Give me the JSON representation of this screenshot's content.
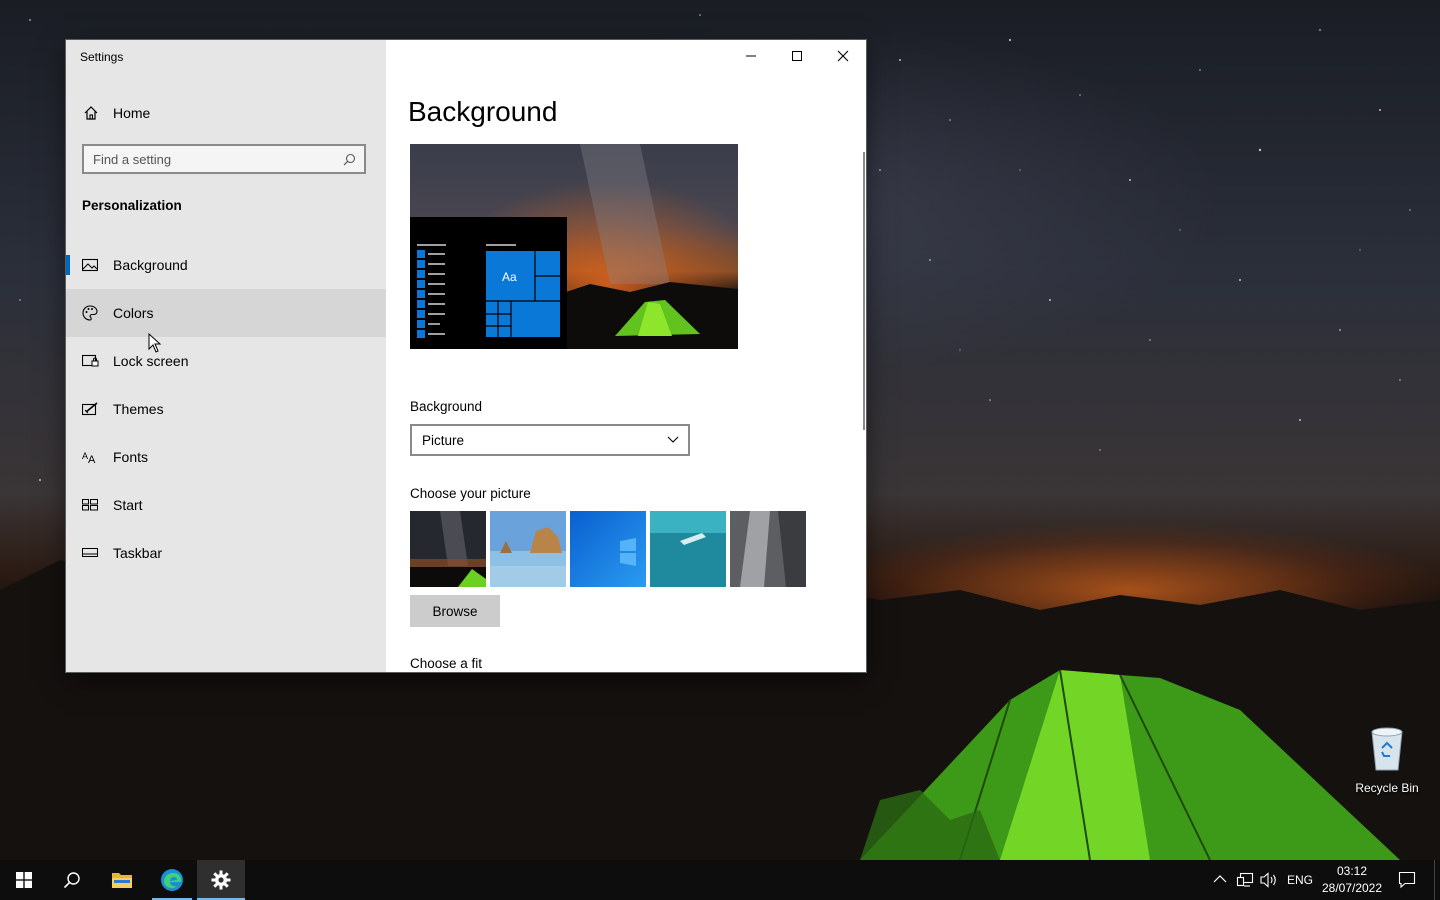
{
  "window": {
    "title": "Settings",
    "controls": [
      "minimize",
      "maximize",
      "close"
    ]
  },
  "sidebar": {
    "home_label": "Home",
    "search_placeholder": "Find a setting",
    "section": "Personalization",
    "items": [
      {
        "label": "Background",
        "icon": "picture-icon",
        "selected": true
      },
      {
        "label": "Colors",
        "icon": "palette-icon",
        "hovered": true
      },
      {
        "label": "Lock screen",
        "icon": "lock-screen-icon"
      },
      {
        "label": "Themes",
        "icon": "themes-icon"
      },
      {
        "label": "Fonts",
        "icon": "fonts-icon"
      },
      {
        "label": "Start",
        "icon": "start-icon"
      },
      {
        "label": "Taskbar",
        "icon": "taskbar-icon"
      }
    ]
  },
  "main": {
    "title": "Background",
    "preview_tile_text": "Aa",
    "background_label": "Background",
    "background_value": "Picture",
    "choose_picture_label": "Choose your picture",
    "browse_label": "Browse",
    "choose_fit_label": "Choose a fit"
  },
  "desktop": {
    "recycle_bin_label": "Recycle Bin"
  },
  "taskbar": {
    "language": "ENG",
    "time": "03:12",
    "date": "28/07/2022"
  },
  "colors": {
    "accent": "#0067c0",
    "tile_blue": "#0a78d7",
    "sidebar_bg": "#e6e6e6",
    "taskbar_bg": "#0d0d0d"
  }
}
